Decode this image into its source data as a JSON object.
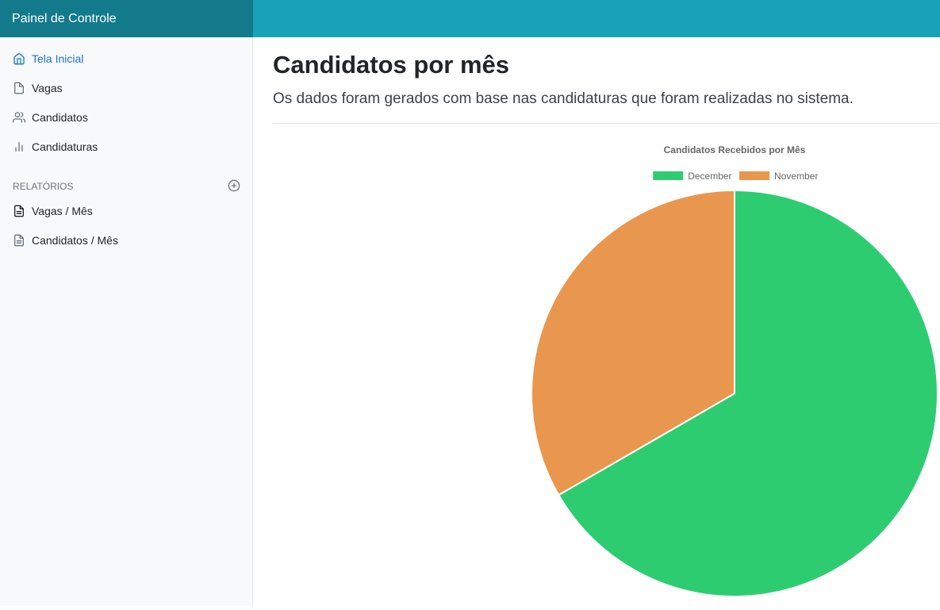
{
  "app": {
    "title": "Painel de Controle"
  },
  "sidebar": {
    "items": [
      {
        "label": "Tela Inicial",
        "icon": "home-icon",
        "active": true
      },
      {
        "label": "Vagas",
        "icon": "file-icon",
        "active": false
      },
      {
        "label": "Candidatos",
        "icon": "users-icon",
        "active": false
      },
      {
        "label": "Candidaturas",
        "icon": "bar-chart-icon",
        "active": false
      }
    ],
    "reports_heading": "RELATÓRIOS",
    "reports": [
      {
        "label": "Vagas / Mês",
        "icon": "file-text-icon"
      },
      {
        "label": "Candidatos / Mês",
        "icon": "file-text-icon"
      }
    ]
  },
  "main": {
    "title": "Candidatos por mês",
    "lead": "Os dados foram gerados com base nas candidaturas que foram realizadas no sistema."
  },
  "colors": {
    "topbar": "#17a2b8",
    "brand": "#137a8c",
    "december": "#2ecc71",
    "november": "#e9964e"
  },
  "chart_data": {
    "type": "pie",
    "title": "Candidatos Recebidos por Mês",
    "categories": [
      "December",
      "November"
    ],
    "values": [
      2,
      1
    ],
    "colors": [
      "#2ecc71",
      "#e9964e"
    ],
    "legend": "top"
  }
}
